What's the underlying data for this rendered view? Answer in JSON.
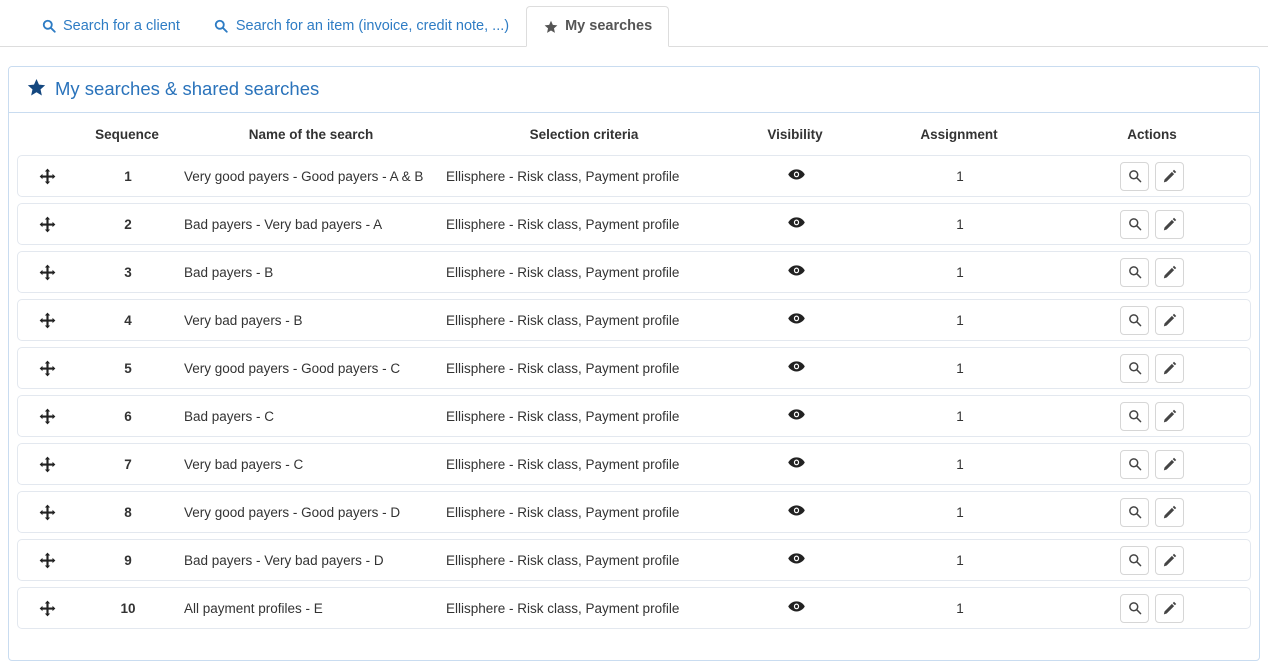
{
  "tabs": [
    {
      "label": "Search for a client",
      "icon": "search-icon",
      "active": false
    },
    {
      "label": "Search for an item (invoice, credit note, ...)",
      "icon": "search-icon",
      "active": false
    },
    {
      "label": "My searches",
      "icon": "star-icon",
      "active": true
    }
  ],
  "panel": {
    "icon": "star-icon",
    "title": "My searches & shared searches"
  },
  "table": {
    "columns": [
      "",
      "Sequence",
      "Name of the search",
      "Selection criteria",
      "Visibility",
      "Assignment",
      "Actions"
    ],
    "row_icons": {
      "drag": "move-arrows-icon",
      "visibility": "eye-icon",
      "view": "magnifier-icon",
      "edit": "pencil-icon"
    },
    "rows": [
      {
        "sequence": "1",
        "name": "Very good payers - Good payers - A & B",
        "criteria": "Ellisphere - Risk class, Payment profile",
        "assignment": "1"
      },
      {
        "sequence": "2",
        "name": "Bad payers - Very bad payers - A",
        "criteria": "Ellisphere - Risk class, Payment profile",
        "assignment": "1"
      },
      {
        "sequence": "3",
        "name": "Bad payers - B",
        "criteria": "Ellisphere - Risk class, Payment profile",
        "assignment": "1"
      },
      {
        "sequence": "4",
        "name": "Very bad payers - B",
        "criteria": "Ellisphere - Risk class, Payment profile",
        "assignment": "1"
      },
      {
        "sequence": "5",
        "name": "Very good payers - Good payers - C",
        "criteria": "Ellisphere - Risk class, Payment profile",
        "assignment": "1"
      },
      {
        "sequence": "6",
        "name": "Bad payers - C",
        "criteria": "Ellisphere - Risk class, Payment profile",
        "assignment": "1"
      },
      {
        "sequence": "7",
        "name": "Very bad payers - C",
        "criteria": "Ellisphere - Risk class, Payment profile",
        "assignment": "1"
      },
      {
        "sequence": "8",
        "name": "Very good payers - Good payers - D",
        "criteria": "Ellisphere - Risk class, Payment profile",
        "assignment": "1"
      },
      {
        "sequence": "9",
        "name": "Bad payers - Very bad payers - D",
        "criteria": "Ellisphere - Risk class, Payment profile",
        "assignment": "1"
      },
      {
        "sequence": "10",
        "name": "All payment profiles - E",
        "criteria": "Ellisphere - Risk class, Payment profile",
        "assignment": "1"
      }
    ]
  },
  "colors": {
    "tab_link": "#2e7cc4",
    "tab_active_text": "#555555",
    "panel_border": "#c9dcf0",
    "panel_title": "#2a73bb",
    "panel_star": "#14477f",
    "row_border": "#e3e8ef",
    "text": "#333333"
  }
}
